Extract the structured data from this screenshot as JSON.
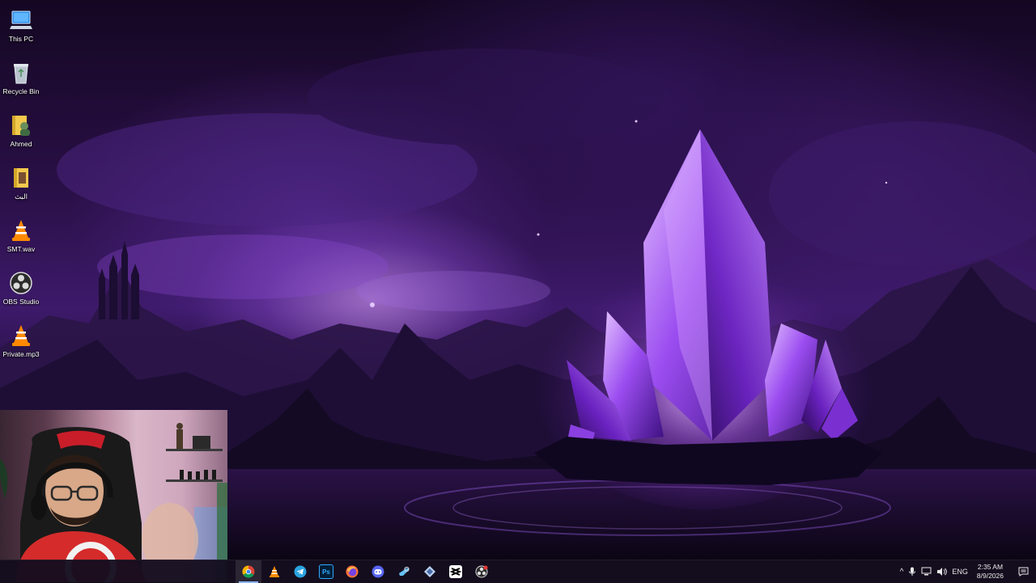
{
  "desktop": {
    "icons": [
      {
        "label": "This PC",
        "icon": "this-pc-icon"
      },
      {
        "label": "Recycle Bin",
        "icon": "recycle-bin-icon"
      },
      {
        "label": "Ahmed",
        "icon": "user-folder-icon"
      },
      {
        "label": "البث",
        "icon": "folder-icon"
      },
      {
        "label": "SMT.wav",
        "icon": "vlc-icon"
      },
      {
        "label": "OBS Studio",
        "icon": "obs-icon"
      },
      {
        "label": "Private.mp3",
        "icon": "vlc-icon"
      }
    ]
  },
  "taskbar": {
    "apps": [
      {
        "name": "chrome",
        "icon": "chrome-icon",
        "active": true
      },
      {
        "name": "vlc",
        "icon": "vlc-icon",
        "active": false
      },
      {
        "name": "telegram",
        "icon": "telegram-icon",
        "active": false
      },
      {
        "name": "photoshop",
        "icon": "photoshop-icon",
        "active": false
      },
      {
        "name": "firefox",
        "icon": "firefox-icon",
        "active": false
      },
      {
        "name": "discord",
        "icon": "discord-icon",
        "active": false
      },
      {
        "name": "steam",
        "icon": "steam-icon",
        "active": false
      },
      {
        "name": "visual-studio",
        "icon": "visual-studio-icon",
        "active": false
      },
      {
        "name": "capcut",
        "icon": "capcut-icon",
        "active": false
      },
      {
        "name": "obs",
        "icon": "obs-icon",
        "active": false
      }
    ],
    "ps_label": "Ps",
    "tray": {
      "chevron": "^",
      "language": "ENG",
      "time": "2:35 AM",
      "date": "8/9/2026"
    }
  },
  "colors": {
    "taskbar_bg": "#140e1e",
    "accent": "#8ab4ff",
    "crystal": "#a855f7"
  }
}
